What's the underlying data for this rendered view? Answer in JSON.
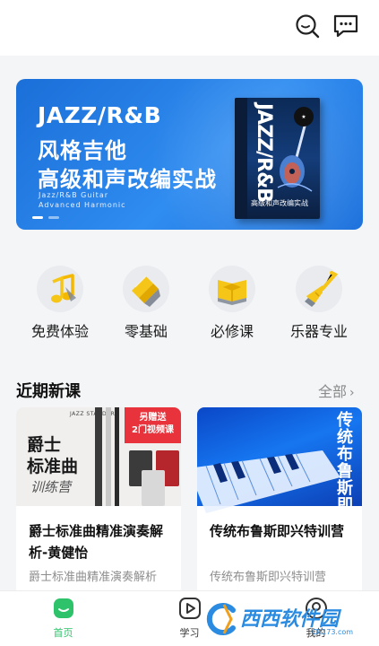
{
  "header": {
    "search_icon": "search-icon",
    "message_icon": "message-icon"
  },
  "banner": {
    "title_line1": "JAZZ/R&B",
    "title_line2": "风格吉他",
    "title_line3": "高级和声改编实战",
    "subtitle": "Jazz/R&B Guitar Advanced Harmonic",
    "book_title": "JAZZ/R&B",
    "book_subtitle": "高级和声改编实战",
    "slide_count": 2,
    "active_slide": 1
  },
  "categories": [
    {
      "label": "免费体验",
      "icon": "music-note-icon"
    },
    {
      "label": "零基础",
      "icon": "blocks-icon"
    },
    {
      "label": "必修课",
      "icon": "book-icon"
    },
    {
      "label": "乐器专业",
      "icon": "guitar-icon"
    }
  ],
  "section": {
    "title": "近期新课",
    "more_label": "全部"
  },
  "courses": [
    {
      "title": "爵士标准曲精准演奏解析-黄健怡",
      "description": "爵士标准曲精准演奏解析",
      "cover": {
        "heading_line1": "爵士",
        "heading_line2": "标准曲",
        "subheading": "训练营",
        "promo_line1": "另赠送",
        "promo_line2": "2门视频课"
      }
    },
    {
      "title": "传统布鲁斯即兴特训营",
      "description": "传统布鲁斯即兴特训营",
      "cover": {
        "vertical_text": "传统布鲁斯即兴"
      }
    }
  ],
  "tabbar": {
    "items": [
      {
        "label": "首页",
        "icon": "home-icon",
        "active": true
      },
      {
        "label": "学习",
        "icon": "play-icon",
        "active": false
      },
      {
        "label": "我的",
        "icon": "profile-icon",
        "active": false
      }
    ]
  },
  "watermark": {
    "text": "西西软件园",
    "sub": "CR173.com"
  },
  "colors": {
    "accent": "#2ec36a",
    "banner_blue": "#1f78e0",
    "promo_red": "#e8333c",
    "icon_yellow": "#f5c518"
  }
}
